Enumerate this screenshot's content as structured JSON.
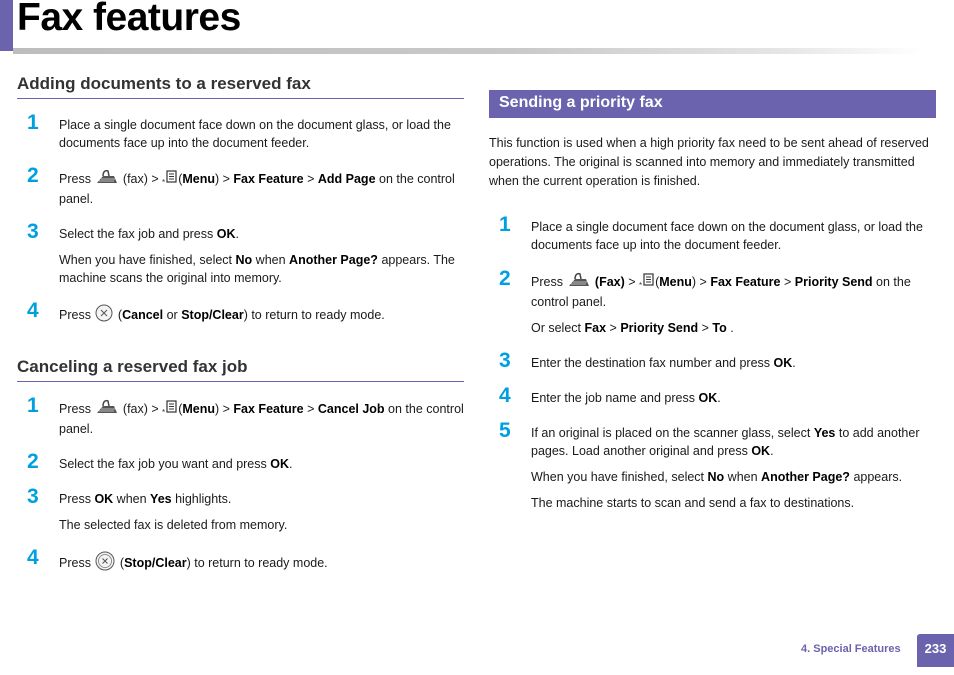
{
  "header": {
    "title": "Fax features"
  },
  "sections": {
    "adding": {
      "title": "Adding documents to a reserved fax",
      "steps": [
        {
          "num": "1",
          "text": "Place a single document face down on the document glass, or load the documents face up into the document feeder."
        },
        {
          "num": "2",
          "press": "Press",
          "fax_label": "(fax) >",
          "menu_open": "(",
          "menu": "Menu",
          "menu_close": ") >",
          "feature": "Fax Feature",
          "sep": ">",
          "target": "Add Page",
          "tail": "on the control panel."
        },
        {
          "num": "3",
          "pre": "Select the fax job and press",
          "ok": "OK",
          "post": ".",
          "note_pre": "When you have finished, select",
          "no": "No",
          "note_mid": "when",
          "another": "Another Page?",
          "note_post": "appears. The machine scans the original into memory."
        },
        {
          "num": "4",
          "press": "Press",
          "open": "(",
          "cancel": "Cancel",
          "or": "or",
          "stop": "Stop/Clear",
          "post": ") to return to ready mode."
        }
      ]
    },
    "canceling": {
      "title": "Canceling a reserved fax job",
      "steps": [
        {
          "num": "1",
          "press": "Press",
          "fax_label": "(fax) >",
          "menu_open": "(",
          "menu": "Menu",
          "menu_close": ") >",
          "feature": "Fax Feature",
          "sep": ">",
          "target": "Cancel Job",
          "tail": "on the control panel."
        },
        {
          "num": "2",
          "pre": "Select the fax job you want and press",
          "ok": "OK",
          "post": "."
        },
        {
          "num": "3",
          "pre": "Press",
          "ok": "OK",
          "mid": "when",
          "yes": "Yes",
          "post": "highlights.",
          "note": "The selected fax is deleted from memory."
        },
        {
          "num": "4",
          "press": "Press",
          "open": "(",
          "stop": "Stop/Clear",
          "post": ") to return to ready mode."
        }
      ]
    },
    "priority": {
      "title": "Sending a priority fax",
      "intro": "This function is used when a high priority fax need to be sent ahead of reserved operations. The original is scanned into memory and immediately transmitted when the current operation is finished.",
      "steps": [
        {
          "num": "1",
          "text": "Place a single document face down on the document glass, or load the documents face up into the document feeder."
        },
        {
          "num": "2",
          "press": "Press",
          "fax": "(Fax)",
          "gt": ">",
          "menu_open": "(",
          "menu": "Menu",
          "menu_close": ") >",
          "feature": "Fax Feature",
          "sep": ">",
          "target": "Priority Send",
          "tail": "on the control panel.",
          "alt_pre": "Or select",
          "alt_fax": "Fax",
          "alt_sep1": ">",
          "alt_priority": "Priority Send",
          "alt_sep2": ">",
          "alt_to": "To",
          "alt_post": "."
        },
        {
          "num": "3",
          "pre": "Enter the destination fax number and press",
          "ok": "OK",
          "post": "."
        },
        {
          "num": "4",
          "pre": "Enter the job name and press",
          "ok": "OK",
          "post": "."
        },
        {
          "num": "5",
          "pre": "If an original is placed on the scanner glass, select",
          "yes": "Yes",
          "mid": "to add another pages. Load another original and press",
          "ok": "OK",
          "post": ".",
          "note1_pre": "When you have finished, select",
          "no": "No",
          "note1_mid": "when",
          "another": "Another Page?",
          "note1_post": "appears.",
          "note2": "The machine starts to scan and send a fax to destinations."
        }
      ]
    }
  },
  "footer": {
    "chapter": "4.  Special Features",
    "page": "233"
  },
  "icons": {
    "fax": "fax-icon",
    "menu": "menu-icon",
    "stop": "stop-clear-icon"
  },
  "colors": {
    "accent": "#6b63ad",
    "step_number": "#00a0e0"
  }
}
